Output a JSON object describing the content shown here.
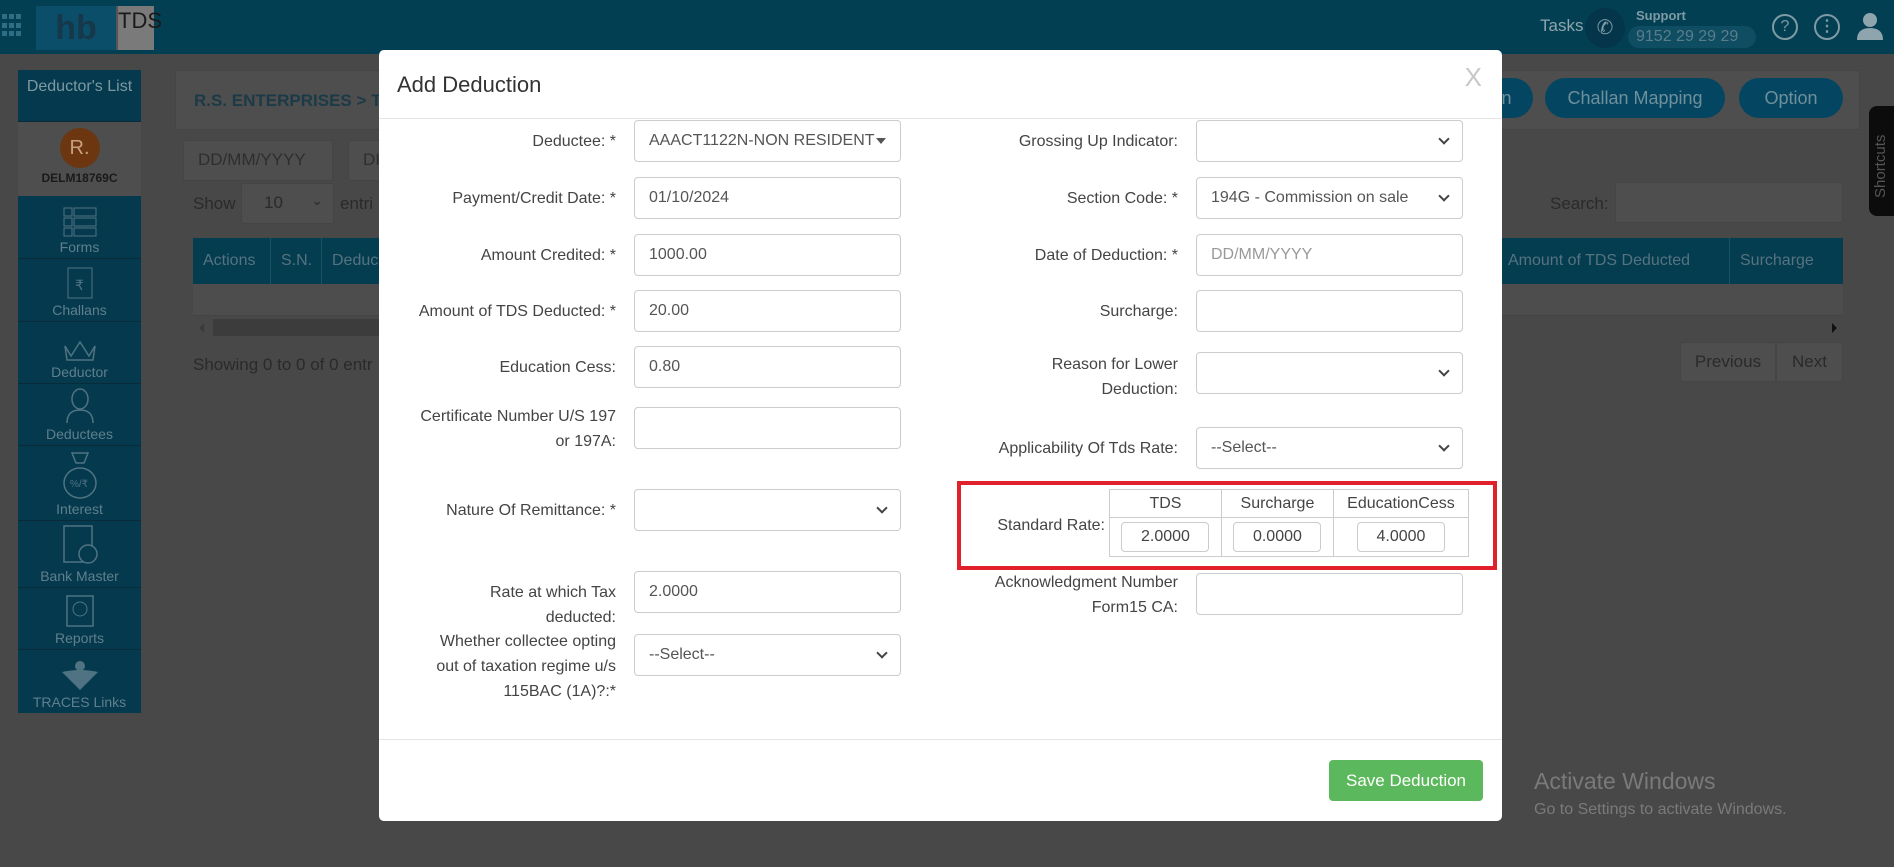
{
  "topbar": {
    "logo_hb": "hb",
    "logo_tds": "TDS",
    "tasks": "Tasks",
    "support_label": "Support",
    "support_number": "9152 29 29 29",
    "icons": [
      "apps-grid-icon",
      "phone-icon",
      "help-icon",
      "more-vertical-icon",
      "user-icon"
    ]
  },
  "sidebar": {
    "header": "Deductor's List",
    "avatar_initial": "R.",
    "deductor_id": "DELM18769C",
    "items": [
      {
        "label": "Forms",
        "icon": "forms-icon"
      },
      {
        "label": "Challans",
        "icon": "challan-icon"
      },
      {
        "label": "Deductor",
        "icon": "crown-icon"
      },
      {
        "label": "Deductees",
        "icon": "person-icon"
      },
      {
        "label": "Interest",
        "icon": "money-bag-icon"
      },
      {
        "label": "Bank Master",
        "icon": "bank-doc-icon"
      },
      {
        "label": "Reports",
        "icon": "report-icon"
      },
      {
        "label": "TRACES Links",
        "icon": "traces-icon"
      }
    ]
  },
  "main": {
    "breadcrumb": "R.S. ENTERPRISES > TDS",
    "buttons": {
      "partial": "n",
      "challan_mapping": "Challan Mapping",
      "option": "Option"
    },
    "date_from_placeholder": "DD/MM/YYYY",
    "date_to_partial": "DI",
    "show_label": "Show",
    "page_size": "10",
    "entries_partial": "entri",
    "search_label": "Search:",
    "columns_left": [
      "Actions",
      "S.N.",
      "Deduc"
    ],
    "columns_right": [
      "Amount of TDS Deducted",
      "Surcharge"
    ],
    "info_partial": "Showing 0 to 0 of 0 entr",
    "previous": "Previous",
    "next": "Next",
    "shortcuts": "Shortcuts"
  },
  "modal": {
    "title": "Add Deduction",
    "close": "X",
    "left": [
      {
        "label": "Deductee: *",
        "value": "AAACT1122N-NON RESIDENT",
        "type": "combo"
      },
      {
        "label": "Payment/Credit Date: *",
        "value": "01/10/2024",
        "type": "input"
      },
      {
        "label": "Amount Credited: *",
        "value": "1000.00",
        "type": "input"
      },
      {
        "label": "Amount of TDS Deducted: *",
        "value": "20.00",
        "type": "input"
      },
      {
        "label": "Education Cess:",
        "value": "0.80",
        "type": "input"
      },
      {
        "label": "Certificate Number U/S 197 or 197A:",
        "value": "",
        "type": "input"
      },
      {
        "label": "Nature Of Remittance: *",
        "value": "",
        "type": "select"
      },
      {
        "label": "Rate at which Tax deducted:",
        "value": "2.0000",
        "type": "input"
      },
      {
        "label": "Whether collectee opting out of taxation regime u/s 115BAC (1A)?:*",
        "value": "--Select--",
        "type": "select"
      }
    ],
    "right": [
      {
        "label": "Grossing Up Indicator:",
        "value": "",
        "type": "select"
      },
      {
        "label": "Section Code: *",
        "value": "194G - Commission on sale",
        "type": "select"
      },
      {
        "label": "Date of Deduction: *",
        "value": "",
        "placeholder": "DD/MM/YYYY",
        "type": "input"
      },
      {
        "label": "Surcharge:",
        "value": "",
        "type": "input"
      },
      {
        "label": "Reason for Lower Deduction:",
        "value": "",
        "type": "select"
      },
      {
        "label": "Applicability Of Tds Rate:",
        "value": "--Select--",
        "type": "select"
      },
      {
        "label": "Acknowledgment Number Form15 CA:",
        "value": "",
        "type": "input"
      }
    ],
    "standard_rate": {
      "label": "Standard Rate:",
      "headers": [
        "TDS",
        "Surcharge",
        "EducationCess"
      ],
      "values": [
        "2.0000",
        "0.0000",
        "4.0000"
      ],
      "highlight_color": "#e0202a"
    },
    "save_label": "Save Deduction",
    "save_color": "#5cb85c"
  },
  "watermark": {
    "title": "Activate Windows",
    "subtitle": "Go to Settings to activate Windows."
  }
}
